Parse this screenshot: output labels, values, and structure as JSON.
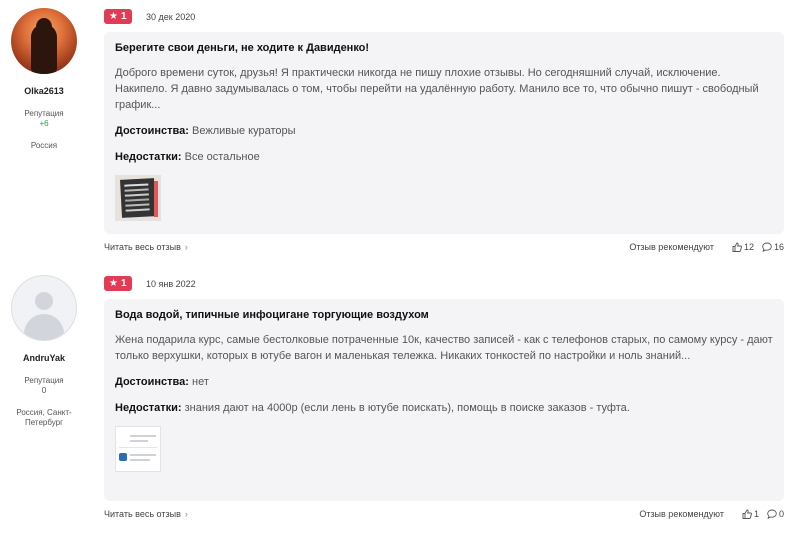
{
  "reviews": [
    {
      "author": {
        "name": "Olka2613",
        "reputation_label": "Репутация",
        "reputation_value": "+6",
        "location": "Россия"
      },
      "rating": "1",
      "date": "30 дек 2020",
      "title": "Берегите свои деньги, не ходите к Давиденко!",
      "text": "Доброго времени суток, друзья! Я практически никогда не пишу плохие отзывы. Но сегодняшний случай, исключение. Накипело. Я давно задумывалась о том, чтобы перейти на удалённую работу. Манило все то, что обычно пишут - свободный график...",
      "pros_label": "Достоинства:",
      "pros": "Вежливые кураторы",
      "cons_label": "Недостатки:",
      "cons": "Все остальное",
      "read_more": "Читать весь отзыв",
      "recommended": "Отзыв рекомендуют",
      "likes": "12",
      "comments": "16"
    },
    {
      "author": {
        "name": "AndruYak",
        "reputation_label": "Репутация",
        "reputation_value": "0",
        "location": "Россия, Санкт-Петербург"
      },
      "rating": "1",
      "date": "10 янв 2022",
      "title": "Вода водой, типичные инфоцигане торгующие воздухом",
      "text": "Жена подарила курс, самые бестолковые потраченные 10к, качество записей - как с телефонов старых, по самому курсу - дают только верхушки, которых в ютубе вагон и маленькая тележка. Никаких тонкостей по настройки и ноль знаний...",
      "pros_label": "Достоинства:",
      "pros": "нет",
      "cons_label": "Недостатки:",
      "cons": "знания дают на 4000р (если лень в ютубе поискать), помощь в поиске заказов - туфта.",
      "read_more": "Читать весь отзыв",
      "recommended": "Отзыв рекомендуют",
      "likes": "1",
      "comments": "0"
    }
  ],
  "colors": {
    "rating_badge": "#e23b55",
    "card_bg": "#f4f4f6",
    "reputation_positive": "#2e9d3a"
  },
  "icons": {
    "rating": "star-icon",
    "like": "thumbs-up-icon",
    "comment": "comment-icon",
    "more": "chevron-right-icon"
  }
}
